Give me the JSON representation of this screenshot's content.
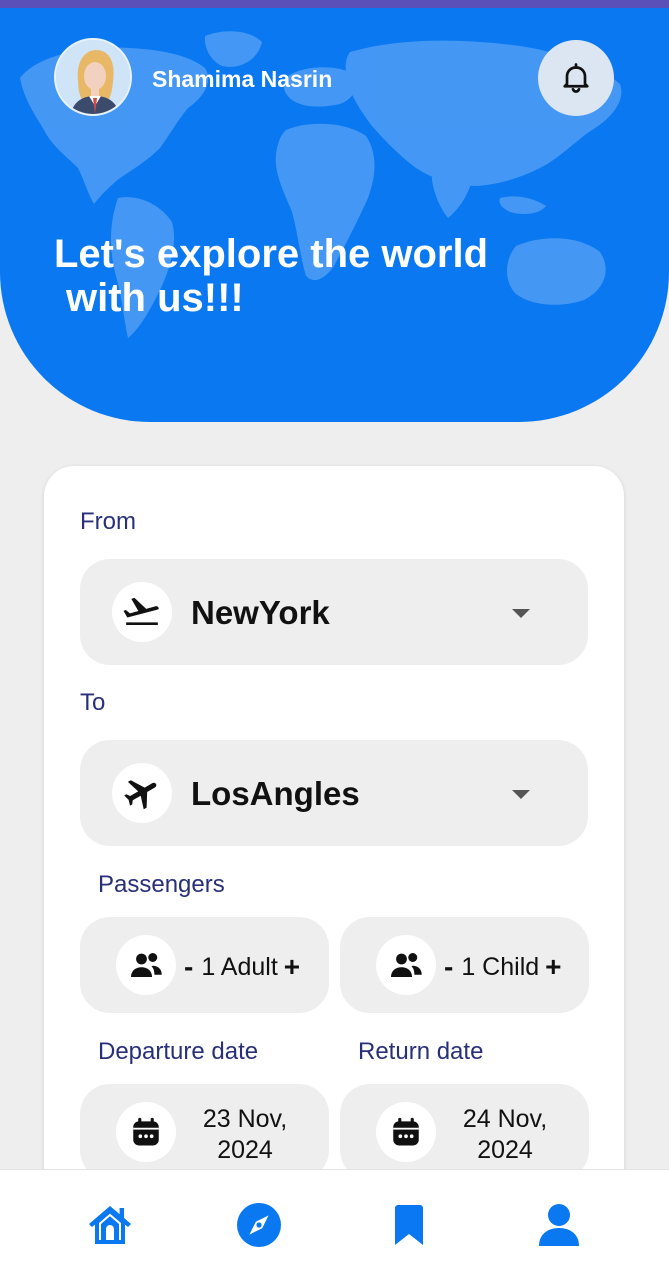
{
  "header": {
    "user_name": "Shamima Nasrin",
    "title_line1": "Let's explore the world",
    "title_line2": "with us!!!"
  },
  "form": {
    "from_label": "From",
    "from_value": "NewYork",
    "to_label": "To",
    "to_value": "LosAngles",
    "passengers_label": "Passengers",
    "adult": {
      "minus": "-",
      "text": "1 Adult",
      "plus": "+"
    },
    "child": {
      "minus": "-",
      "text": "1 Child",
      "plus": "+"
    },
    "departure_label": "Departure date",
    "departure_line1": "23 Nov,",
    "departure_line2": "2024",
    "return_label": "Return date",
    "return_line1": "24 Nov,",
    "return_line2": "2024"
  },
  "icons": {
    "bell": "bell-icon",
    "departure": "plane-takeoff-icon",
    "arrival": "plane-icon",
    "people": "people-icon",
    "calendar": "calendar-icon",
    "home": "home-icon",
    "explore": "compass-icon",
    "bookmark": "bookmark-icon",
    "profile": "user-icon"
  },
  "colors": {
    "primary": "#0a78f0",
    "label": "#28307a",
    "background": "#eeeeee"
  }
}
